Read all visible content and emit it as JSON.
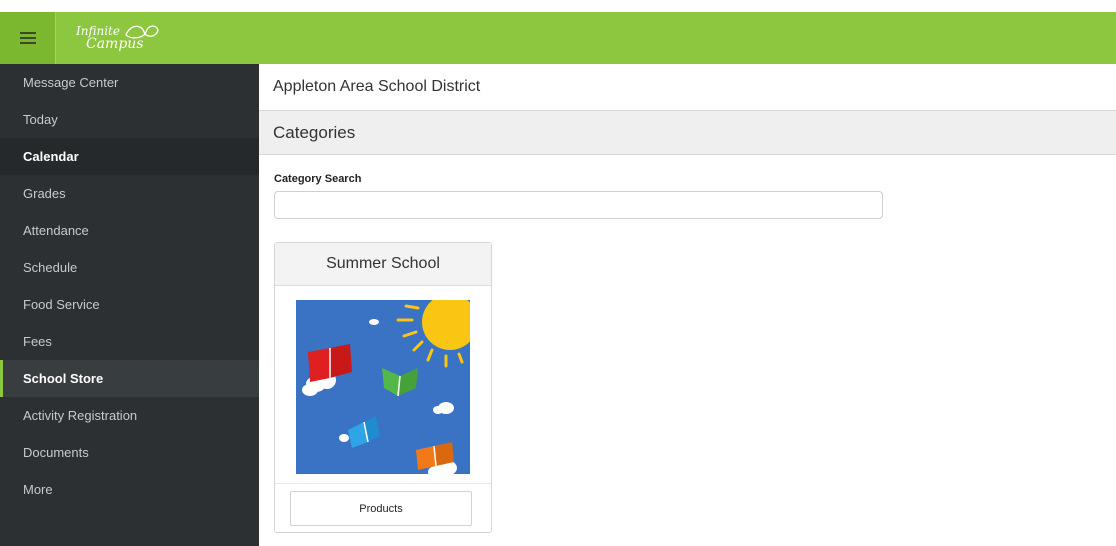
{
  "header": {
    "menu_icon": "hamburger-menu-icon",
    "logo_line1": "Infinite",
    "logo_line2": "Campus",
    "accent_color": "#8dc63f"
  },
  "sidebar": {
    "items": [
      {
        "label": "Message Center"
      },
      {
        "label": "Today"
      },
      {
        "label": "Calendar"
      },
      {
        "label": "Grades"
      },
      {
        "label": "Attendance"
      },
      {
        "label": "Schedule"
      },
      {
        "label": "Food Service"
      },
      {
        "label": "Fees"
      },
      {
        "label": "School Store"
      },
      {
        "label": "Activity Registration"
      },
      {
        "label": "Documents"
      },
      {
        "label": "More"
      }
    ]
  },
  "main": {
    "district": "Appleton Area School District",
    "page_title": "Categories",
    "search": {
      "label": "Category Search",
      "value": "",
      "placeholder": ""
    },
    "categories": [
      {
        "title": "Summer School",
        "image_icon": "summer-books-illustration",
        "button_label": "Products"
      }
    ]
  }
}
